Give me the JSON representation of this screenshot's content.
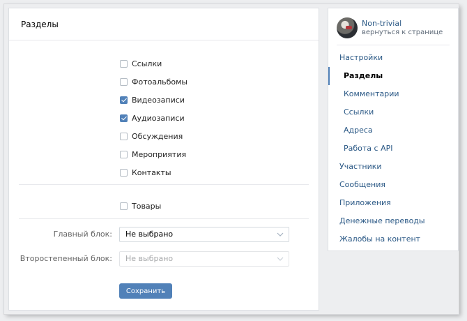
{
  "main": {
    "title": "Разделы",
    "sections": [
      {
        "label": "Ссылки",
        "checked": false
      },
      {
        "label": "Фотоальбомы",
        "checked": false
      },
      {
        "label": "Видеозаписи",
        "checked": true
      },
      {
        "label": "Аудиозаписи",
        "checked": true
      },
      {
        "label": "Обсуждения",
        "checked": false
      },
      {
        "label": "Мероприятия",
        "checked": false
      },
      {
        "label": "Контакты",
        "checked": false
      }
    ],
    "goods": {
      "label": "Товары",
      "checked": false
    },
    "main_block": {
      "label": "Главный блок:",
      "value": "Не выбрано"
    },
    "secondary_block": {
      "label": "Второстепенный блок:",
      "value": "Не выбрано"
    },
    "save_label": "Сохранить"
  },
  "sidebar": {
    "profile": {
      "name": "Non-trivial",
      "back_link": "вернуться к странице"
    },
    "nav": [
      {
        "label": "Настройки",
        "sub": false,
        "active": false
      },
      {
        "label": "Разделы",
        "sub": true,
        "active": true
      },
      {
        "label": "Комментарии",
        "sub": true,
        "active": false
      },
      {
        "label": "Ссылки",
        "sub": true,
        "active": false
      },
      {
        "label": "Адреса",
        "sub": true,
        "active": false
      },
      {
        "label": "Работа с API",
        "sub": true,
        "active": false
      },
      {
        "label": "Участники",
        "sub": false,
        "active": false
      },
      {
        "label": "Сообщения",
        "sub": false,
        "active": false
      },
      {
        "label": "Приложения",
        "sub": false,
        "active": false
      },
      {
        "label": "Денежные переводы",
        "sub": false,
        "active": false
      },
      {
        "label": "Жалобы на контент",
        "sub": false,
        "active": false
      }
    ]
  },
  "colors": {
    "accent": "#5181b8",
    "link": "#2a5885"
  }
}
